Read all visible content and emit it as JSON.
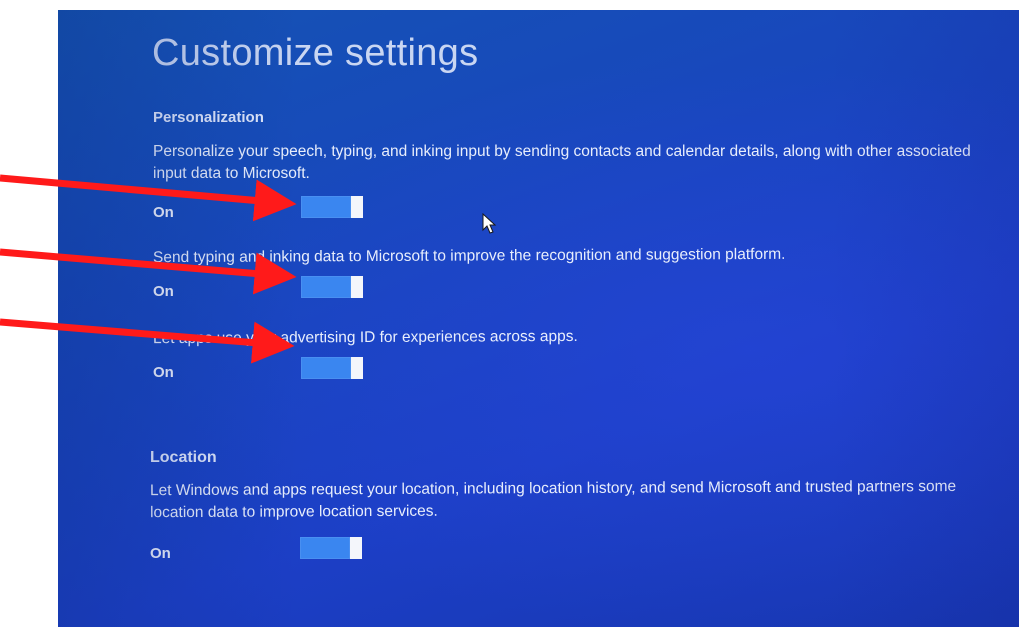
{
  "page": {
    "title": "Customize settings"
  },
  "personalization": {
    "heading": "Personalization",
    "settings": [
      {
        "description": "Personalize your speech, typing, and inking input by sending contacts and calendar details, along with other associated input data to Microsoft.",
        "state": "On",
        "enabled": true
      },
      {
        "description": "Send typing and inking data to Microsoft to improve the recognition and suggestion platform.",
        "state": "On",
        "enabled": true
      },
      {
        "description": "Let apps use your advertising ID for experiences across apps.",
        "state": "On",
        "enabled": true
      }
    ]
  },
  "location": {
    "heading": "Location",
    "settings": [
      {
        "description": "Let Windows and apps request your location, including location history, and send Microsoft and trusted partners some location data to improve location services.",
        "state": "On",
        "enabled": true
      }
    ]
  },
  "colors": {
    "background": "#1847bd",
    "toggle_on": "#3a86f0",
    "annotation_arrow": "#ff1a1a"
  },
  "icons": [
    "mouse-pointer-icon",
    "annotation-arrow-icon"
  ]
}
